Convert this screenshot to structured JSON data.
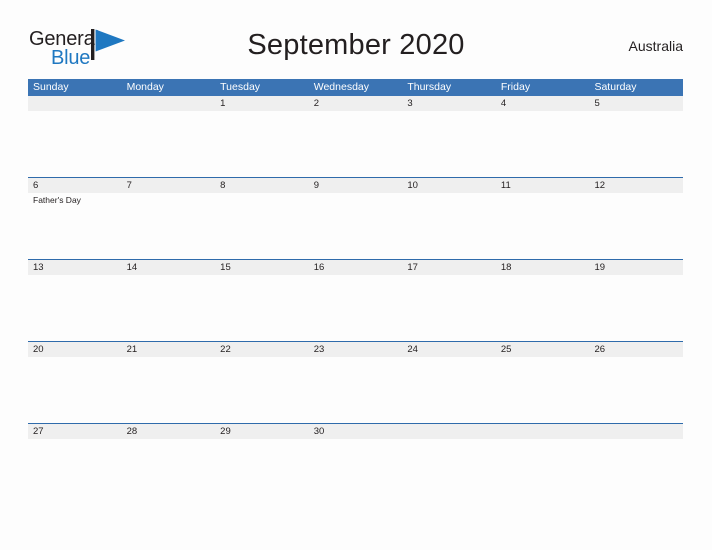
{
  "brand": {
    "word_one": "General",
    "word_two": "Blue",
    "flag_icon": "flag-icon",
    "color_text": "#231f20",
    "color_blue": "#1f78c1"
  },
  "header": {
    "title": "September 2020",
    "region": "Australia"
  },
  "theme": {
    "header_blue": "#3b74b4",
    "separator_blue": "#2f6bab",
    "date_band_gray": "#efefef",
    "page_background": "#fdfdfd",
    "text": "#231f20"
  },
  "calendar": {
    "weekdays": [
      "Sunday",
      "Monday",
      "Tuesday",
      "Wednesday",
      "Thursday",
      "Friday",
      "Saturday"
    ],
    "weeks": [
      {
        "days": [
          {
            "date": "",
            "event": ""
          },
          {
            "date": "",
            "event": ""
          },
          {
            "date": "1",
            "event": ""
          },
          {
            "date": "2",
            "event": ""
          },
          {
            "date": "3",
            "event": ""
          },
          {
            "date": "4",
            "event": ""
          },
          {
            "date": "5",
            "event": ""
          }
        ]
      },
      {
        "days": [
          {
            "date": "6",
            "event": "Father's Day"
          },
          {
            "date": "7",
            "event": ""
          },
          {
            "date": "8",
            "event": ""
          },
          {
            "date": "9",
            "event": ""
          },
          {
            "date": "10",
            "event": ""
          },
          {
            "date": "11",
            "event": ""
          },
          {
            "date": "12",
            "event": ""
          }
        ]
      },
      {
        "days": [
          {
            "date": "13",
            "event": ""
          },
          {
            "date": "14",
            "event": ""
          },
          {
            "date": "15",
            "event": ""
          },
          {
            "date": "16",
            "event": ""
          },
          {
            "date": "17",
            "event": ""
          },
          {
            "date": "18",
            "event": ""
          },
          {
            "date": "19",
            "event": ""
          }
        ]
      },
      {
        "days": [
          {
            "date": "20",
            "event": ""
          },
          {
            "date": "21",
            "event": ""
          },
          {
            "date": "22",
            "event": ""
          },
          {
            "date": "23",
            "event": ""
          },
          {
            "date": "24",
            "event": ""
          },
          {
            "date": "25",
            "event": ""
          },
          {
            "date": "26",
            "event": ""
          }
        ]
      },
      {
        "days": [
          {
            "date": "27",
            "event": ""
          },
          {
            "date": "28",
            "event": ""
          },
          {
            "date": "29",
            "event": ""
          },
          {
            "date": "30",
            "event": ""
          },
          {
            "date": "",
            "event": ""
          },
          {
            "date": "",
            "event": ""
          },
          {
            "date": "",
            "event": ""
          }
        ]
      }
    ]
  }
}
